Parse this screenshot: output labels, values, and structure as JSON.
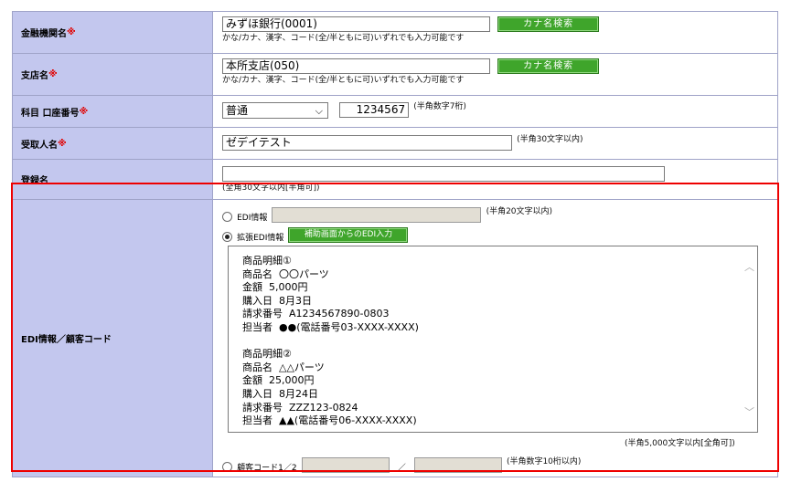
{
  "bank": {
    "label": "金融機関名",
    "required_mark": "※",
    "value": "みずほ銀行(0001)",
    "kana_button": "カナ名検索",
    "hint": "かな/カナ、漢字、コード(全/半ともに可)いずれでも入力可能です"
  },
  "branch": {
    "label": "支店名",
    "required_mark": "※",
    "value": "本所支店(050)",
    "kana_button": "カナ名検索",
    "hint": "かな/カナ、漢字、コード(全/半ともに可)いずれでも入力可能です"
  },
  "account": {
    "label": "科目 口座番号",
    "required_mark": "※",
    "type_selected": "普通",
    "number": "1234567",
    "hint": "(半角数字7桁)"
  },
  "recipient": {
    "label": "受取人名",
    "required_mark": "※",
    "value": "ゼデイテスト",
    "hint": "(半角30文字以内)"
  },
  "registered": {
    "label": "登録名",
    "value": "",
    "hint": "(全角30文字以内[半角可])"
  },
  "edi": {
    "label": "EDI情報／顧客コード",
    "edi_option": "EDI情報",
    "edi_hint": "(半角20文字以内)",
    "ext_option": "拡張EDI情報",
    "assist_button": "補助画面からのEDI入力",
    "textarea": "商品明細①\n商品名  〇〇パーツ\n金額  5,000円\n購入日  8月3日\n請求番号  A1234567890-0803\n担当者  ●●(電話番号03-XXXX-XXXX)\n\n商品明細②\n商品名  △△パーツ\n金額  25,000円\n購入日  8月24日\n請求番号  ZZZ123-0824\n担当者  ▲▲(電話番号06-XXXX-XXXX)",
    "textarea_hint": "(半角5,000文字以内[全角可])",
    "customer_option": "顧客コード1／2",
    "slash": "／",
    "customer_hint": "(半角数字10桁以内)",
    "selected": "ext"
  },
  "colors": {
    "label_bg": "#c3c7ee",
    "button_green": "#3fa52b",
    "highlight_red": "#ee0000",
    "required_red": "#e00000"
  },
  "icons": {
    "scroll_up": "chevron-up-icon",
    "scroll_down": "chevron-down-icon",
    "select_arrow": "chevron-down-icon"
  }
}
